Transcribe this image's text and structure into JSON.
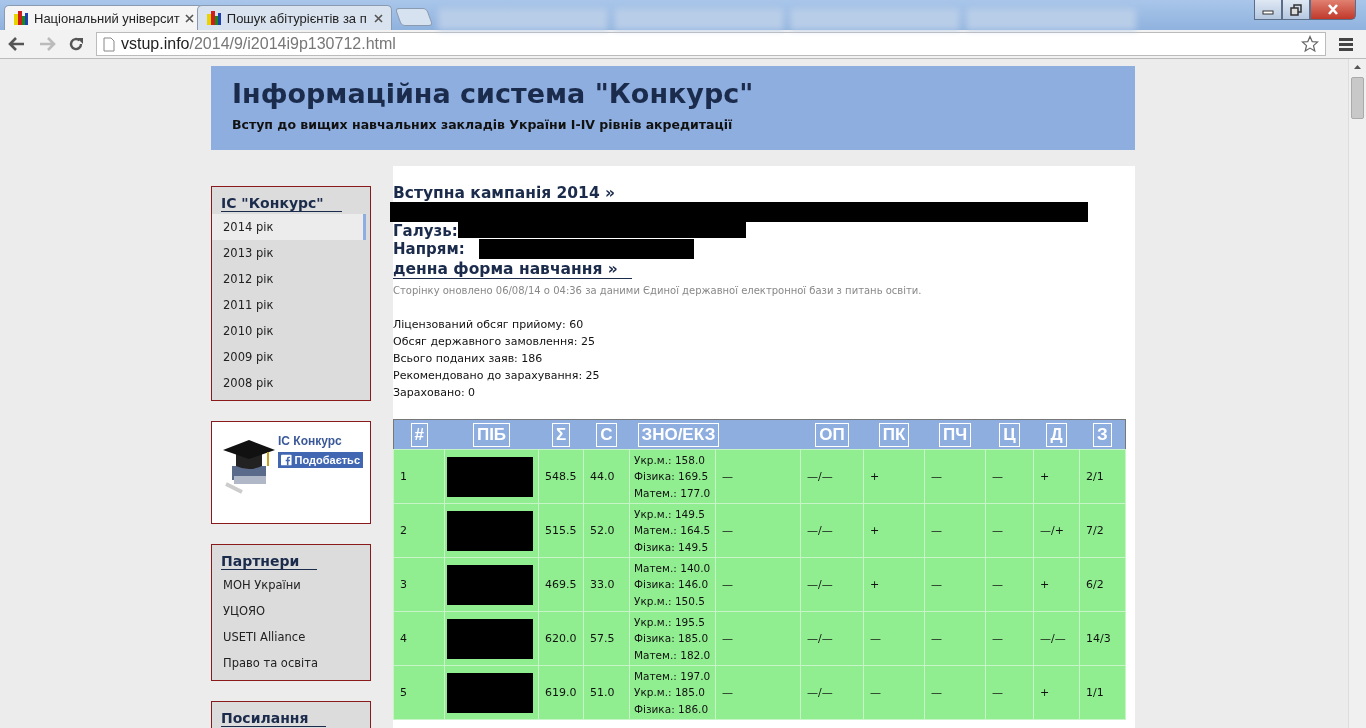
{
  "browser": {
    "tabs": [
      {
        "title": "Національний університ",
        "selected": true
      },
      {
        "title": "Пошук абітурієнтів за п",
        "selected": false
      }
    ],
    "url": {
      "host": "vstup.info",
      "path": "/2014/9/i2014i9p130712.html"
    }
  },
  "banner": {
    "title": "Інформаційна система \"Конкурс\"",
    "subtitle": "Вступ до вищих навчальних закладів України I-IV рівнів акредитації"
  },
  "sidebar": {
    "menu": {
      "title": "ІС \"Конкурс\"",
      "items": [
        {
          "label": "2014 рік",
          "selected": true
        },
        {
          "label": "2013 рік",
          "selected": false
        },
        {
          "label": "2012 рік",
          "selected": false
        },
        {
          "label": "2011 рік",
          "selected": false
        },
        {
          "label": "2010 рік",
          "selected": false
        },
        {
          "label": "2009 рік",
          "selected": false
        },
        {
          "label": "2008 рік",
          "selected": false
        }
      ]
    },
    "social": {
      "name": "ІС Конкурс",
      "button": "Подобаєтьс"
    },
    "partners": {
      "title": "Партнери",
      "items": [
        "МОН України",
        "УЦОЯО",
        "USETI Alliance",
        "Право та освіта"
      ]
    },
    "links": {
      "title": "Посилання"
    }
  },
  "main": {
    "campaign": "Вступна кампанія 2014 »",
    "branch_label": "Галузь:",
    "direction_label": "Напрям:",
    "study_form": "денна форма навчання »",
    "updated": "Сторінку оновлено 06/08/14 о 04:36 за даними Єдиної державної електронної бази з питань освіти.",
    "stats": [
      "Ліцензований обсяг прийому: 60",
      "Обсяг державного замовлення: 25",
      "Всього поданих заяв: 186",
      "Рекомендовано до зарахування: 25",
      "Зараховано: 0"
    ]
  },
  "table": {
    "columns": [
      "#",
      "ПІБ",
      "Σ",
      "С",
      "ЗНО/ЕКЗ",
      "ОП",
      "ПК",
      "ПЧ",
      "Ц",
      "Д",
      "З"
    ],
    "rows": [
      {
        "num": "1",
        "total": "548.5",
        "c": "44.0",
        "zno": [
          "Укр.м.: 158.0",
          "Фізика: 169.5",
          "Матем.: 177.0"
        ],
        "exam": "—",
        "op": "—/—",
        "pk": "+",
        "pch": "—",
        "ts": "—",
        "d": "+",
        "z": "2/1"
      },
      {
        "num": "2",
        "total": "515.5",
        "c": "52.0",
        "zno": [
          "Укр.м.: 149.5",
          "Матем.: 164.5",
          "Фізика: 149.5"
        ],
        "exam": "—",
        "op": "—/—",
        "pk": "+",
        "pch": "—",
        "ts": "—",
        "d": "—/+",
        "z": "7/2"
      },
      {
        "num": "3",
        "total": "469.5",
        "c": "33.0",
        "zno": [
          "Матем.: 140.0",
          "Фізика: 146.0",
          "Укр.м.: 150.5"
        ],
        "exam": "—",
        "op": "—/—",
        "pk": "+",
        "pch": "—",
        "ts": "—",
        "d": "+",
        "z": "6/2"
      },
      {
        "num": "4",
        "total": "620.0",
        "c": "57.5",
        "zno": [
          "Укр.м.: 195.5",
          "Фізика: 185.0",
          "Матем.: 182.0"
        ],
        "exam": "—",
        "op": "—/—",
        "pk": "—",
        "pch": "—",
        "ts": "—",
        "d": "—/—",
        "z": "14/3"
      },
      {
        "num": "5",
        "total": "619.0",
        "c": "51.0",
        "zno": [
          "Матем.: 197.0",
          "Укр.м.: 185.0",
          "Фізика: 186.0"
        ],
        "exam": "—",
        "op": "—/—",
        "pk": "—",
        "pch": "—",
        "ts": "—",
        "d": "+",
        "z": "1/1"
      }
    ]
  }
}
